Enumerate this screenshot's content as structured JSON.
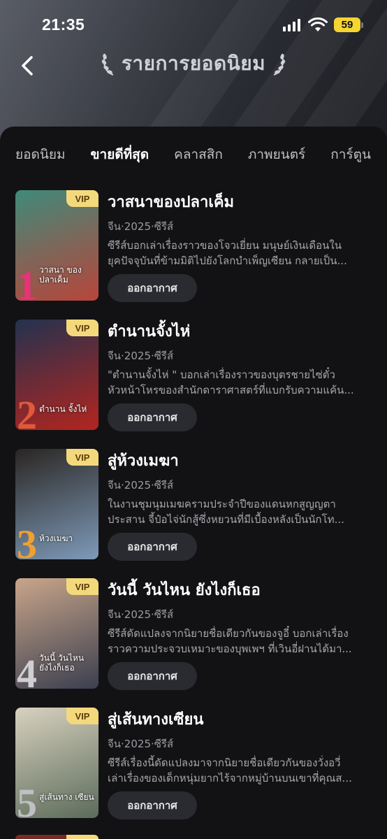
{
  "status_bar": {
    "time": "21:35",
    "battery": "59"
  },
  "header": {
    "title": "รายการยอดนิยม"
  },
  "tabs": [
    {
      "label": "ยอดนิยม",
      "active": false
    },
    {
      "label": "ขายดีที่สุด",
      "active": true
    },
    {
      "label": "คลาสสิก",
      "active": false
    },
    {
      "label": "ภาพยนตร์",
      "active": false
    },
    {
      "label": "การ์ตูน",
      "active": false
    }
  ],
  "items": [
    {
      "rank": "1",
      "badge": "VIP",
      "title": "วาสนาของปลาเค็ม",
      "meta": "จีน·2025·ซีรีส์",
      "desc_line1": "ซีรีส์บอกเล่าเรื่องราวของโจวเยี่ยน มนุษย์เงินเดือนใน",
      "desc_line2": "ยุคปัจจุบันที่ข้ามมิติไปยังโลกบำเพ็ญเซียน กลายเป็น...",
      "poster_caption": "วาสนา ของปลาเค็ม",
      "button": "ออกอากาศ",
      "poster_colors": [
        "#3f8a7a",
        "#b8453a"
      ],
      "rank_color": "#e8327a"
    },
    {
      "rank": "2",
      "badge": "VIP",
      "title": "ตำนานจั้งไห่",
      "meta": "จีน·2025·ซีรีส์",
      "desc_line1": "\"ตำนานจั้งไห่ \" บอกเล่าเรื่องราวของบุตรชายไซ่ตั๋ว",
      "desc_line2": "หัวหน้าโหรของสำนักดาราศาสตร์ที่แบกรับความแค้น...",
      "poster_caption": "ตำนาน จั้งไห่",
      "button": "ออกอากาศ",
      "poster_colors": [
        "#23324f",
        "#b3251f"
      ],
      "rank_color": "#e05a3a"
    },
    {
      "rank": "3",
      "badge": "VIP",
      "title": "สู่ห้วงเมฆา",
      "meta": "จีน·2025·ซีรีส์",
      "desc_line1": "ในงานชุมนุมเมฆครามประจำปีของแดนหกสูญญตา",
      "desc_line2": "ประสาน จี้ป๋อไจ่นักสู้ซึ่งหยวนที่มีเบื้องหลังเป็นนักโท...",
      "poster_caption": "ห้วงเมฆา",
      "button": "ออกอากาศ",
      "poster_colors": [
        "#2a2623",
        "#7e9ab8"
      ],
      "rank_color": "#f0a030"
    },
    {
      "rank": "4",
      "badge": "VIP",
      "title": "วันนี้ วันไหน ยังไงก็เธอ",
      "meta": "จีน·2025·ซีรีส์",
      "desc_line1": "ซีรีส์ดัดแปลงจากนิยายชื่อเดียวกันของจูอี๋ บอกเล่าเรื่อง",
      "desc_line2": "ราวความประจวบเหมาะของบุพเพฯ ที่เวินอี่ฝานได้มา...",
      "poster_caption": "วันนี้ วันไหน ยังไงก็เธอ",
      "button": "ออกอากาศ",
      "poster_colors": [
        "#c9a58a",
        "#3b3f4f"
      ],
      "rank_color": "#cfcfd4"
    },
    {
      "rank": "5",
      "badge": "VIP",
      "title": "สู่เส้นทางเซียน",
      "meta": "จีน·2025·ซีรีส์",
      "desc_line1": "ซีรีส์เรื่องนี้ดัดแปลงมาจากนิยายชื่อเดียวกันของวั่งอวี่",
      "desc_line2": "เล่าเรื่องของเด็กหนุ่มยากไร้จากหมู่บ้านบนเขาที่คุณส...",
      "poster_caption": "สู่เส้นทาง เซียน",
      "button": "ออกอากาศ",
      "poster_colors": [
        "#d8d1bf",
        "#5c6b5a"
      ],
      "rank_color": "#bfbfc4"
    }
  ]
}
